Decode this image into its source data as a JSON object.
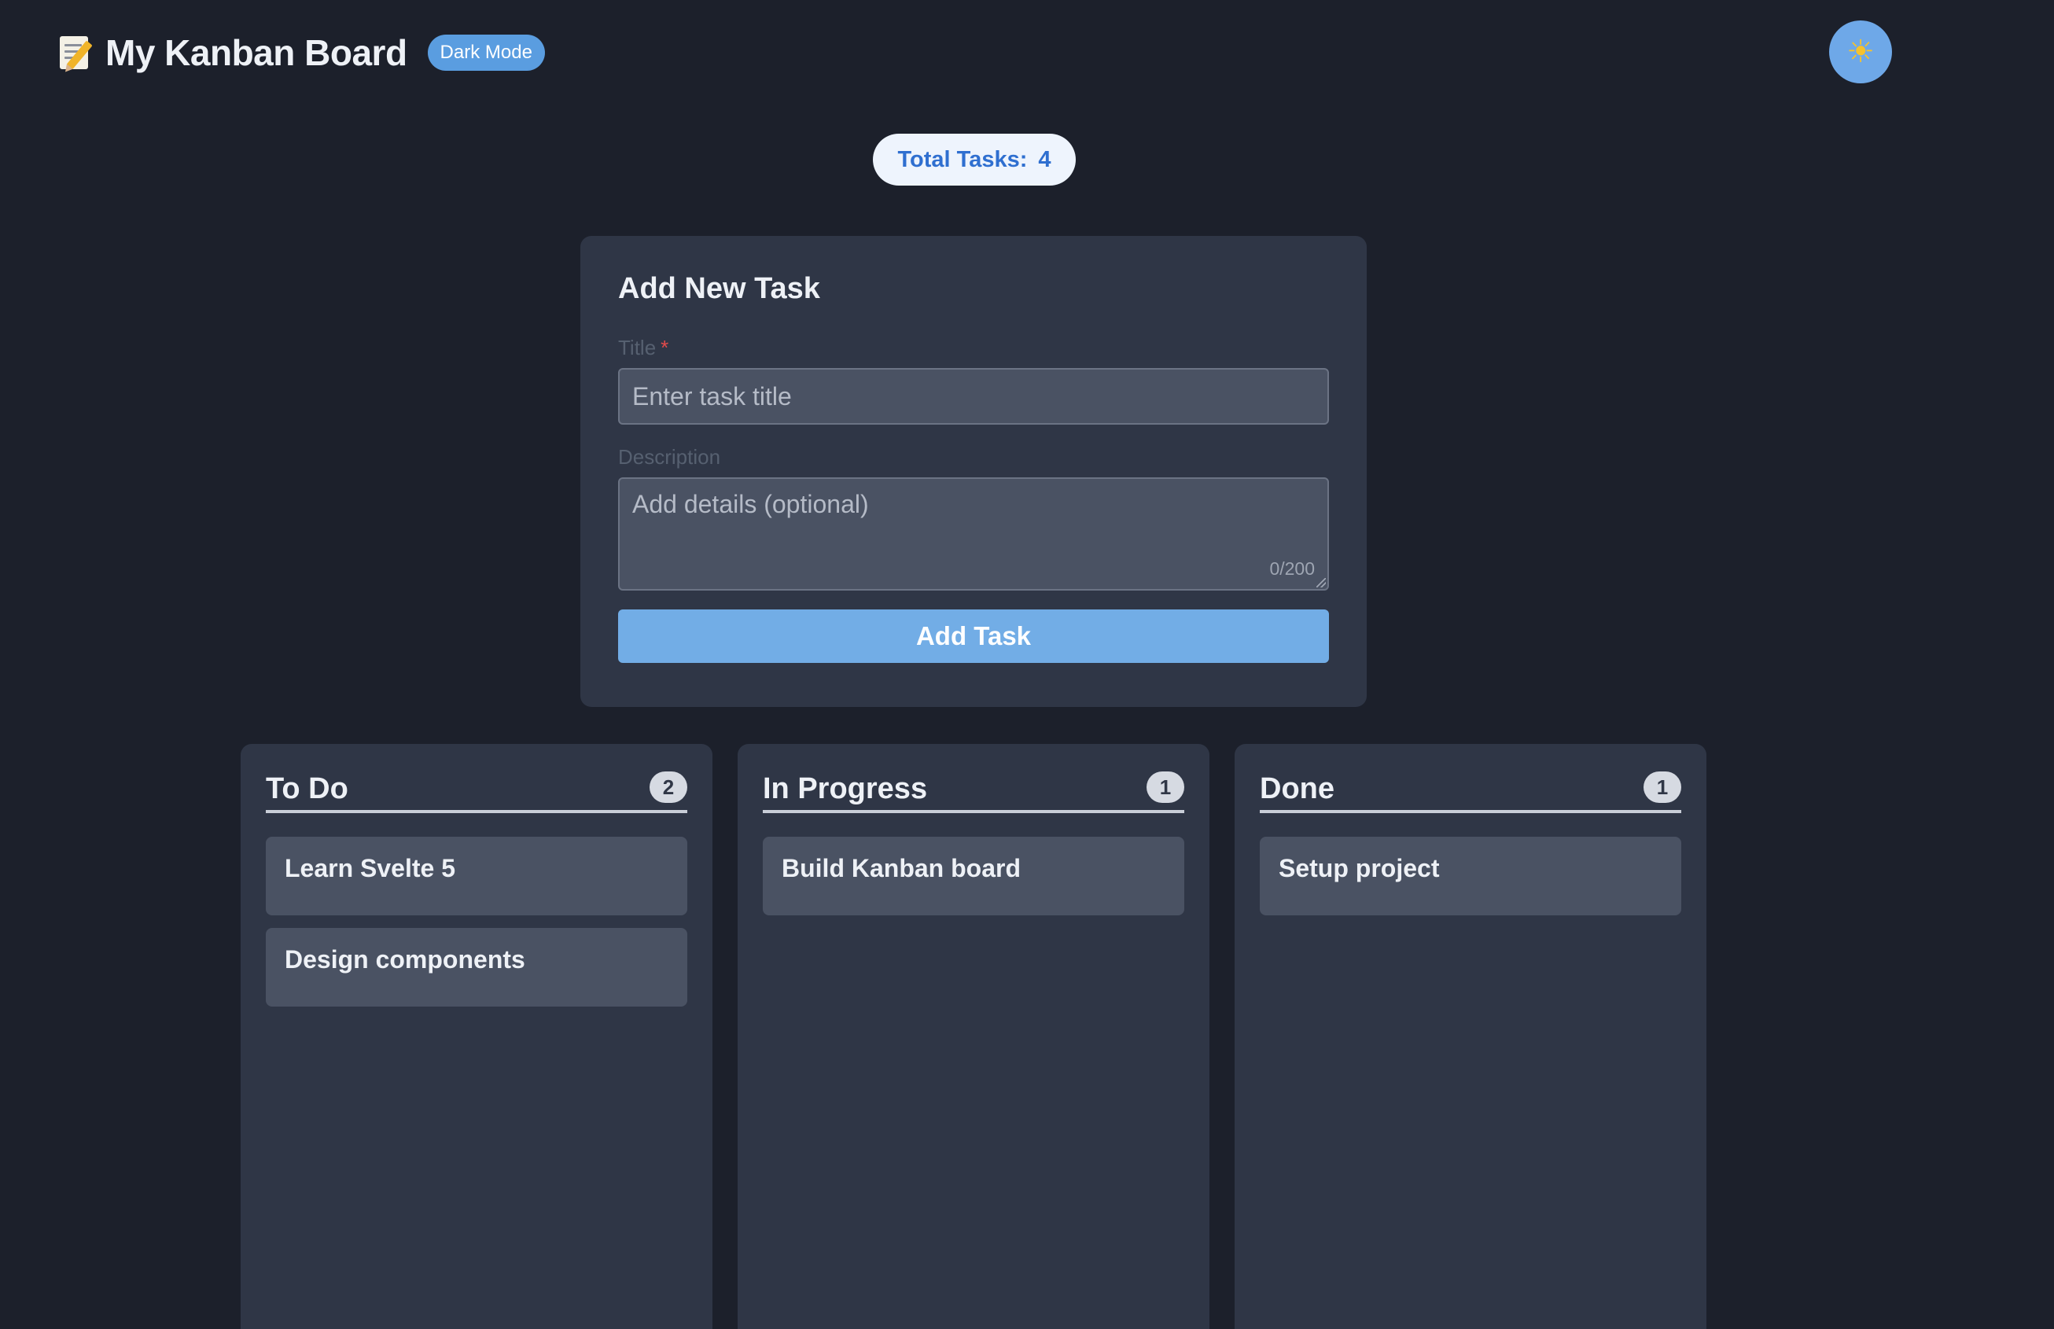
{
  "header": {
    "title": "My Kanban Board",
    "mode_badge": "Dark Mode",
    "theme_toggle_icon": "sun-icon"
  },
  "summary": {
    "total_label": "Total Tasks:",
    "total_count": "4"
  },
  "form": {
    "heading": "Add New Task",
    "title_label": "Title",
    "required_mark": "*",
    "title_placeholder": "Enter task title",
    "title_value": "",
    "description_label": "Description",
    "description_placeholder": "Add details (optional)",
    "description_value": "",
    "char_counter": "0/200",
    "submit_label": "Add Task"
  },
  "columns": [
    {
      "title": "To Do",
      "count": "2",
      "tasks": [
        {
          "title": "Learn Svelte 5"
        },
        {
          "title": "Design components"
        }
      ]
    },
    {
      "title": "In Progress",
      "count": "1",
      "tasks": [
        {
          "title": "Build Kanban board"
        }
      ]
    },
    {
      "title": "Done",
      "count": "1",
      "tasks": [
        {
          "title": "Setup project"
        }
      ]
    }
  ],
  "colors": {
    "background": "#1c202b",
    "panel": "#2f3646",
    "card": "#4a5263",
    "accent": "#72ade6",
    "badge": "#5a9de0",
    "required": "#e24b4b"
  }
}
